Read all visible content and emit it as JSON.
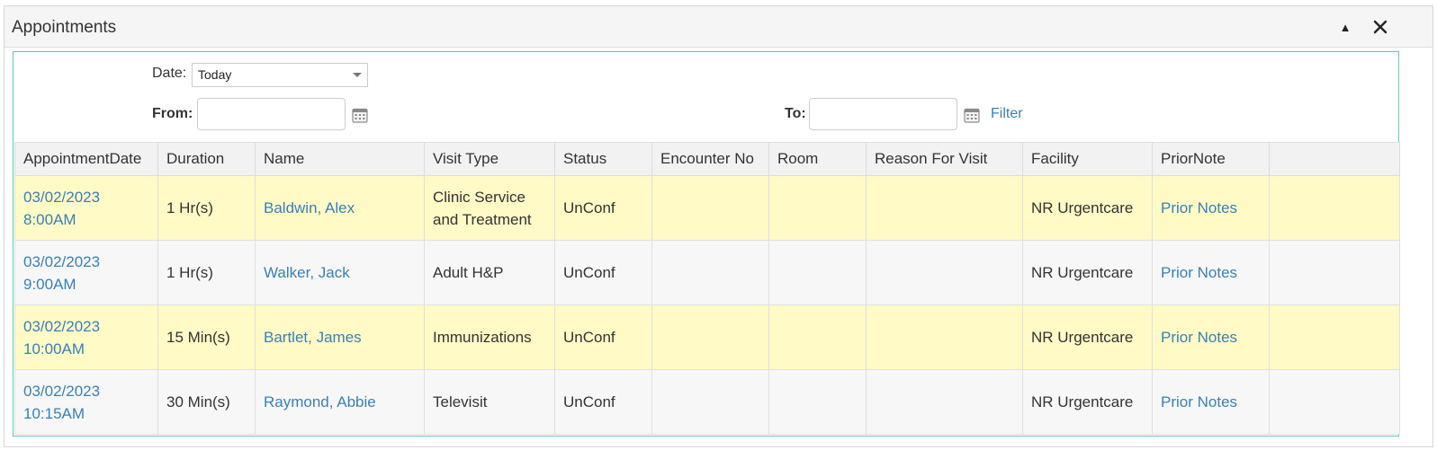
{
  "panel": {
    "title": "Appointments"
  },
  "filters": {
    "date_label": "Date:",
    "date_value": "Today",
    "from_label": "From:",
    "from_value": "",
    "to_label": "To:",
    "to_value": "",
    "filter_label": "Filter"
  },
  "table": {
    "columns": [
      "AppointmentDate",
      "Duration",
      "Name",
      "Visit Type",
      "Status",
      "Encounter No",
      "Room",
      "Reason For Visit",
      "Facility",
      "PriorNote",
      ""
    ],
    "rows": [
      {
        "date": "03/02/2023",
        "time": "8:00AM",
        "duration": "1 Hr(s)",
        "name": "Baldwin, Alex",
        "visit_type": "Clinic Service and Treatment",
        "status": "UnConf",
        "encounter_no": "",
        "room": "",
        "reason": "",
        "facility": "NR Urgentcare",
        "prior_note": "Prior Notes"
      },
      {
        "date": "03/02/2023",
        "time": "9:00AM",
        "duration": "1 Hr(s)",
        "name": "Walker, Jack",
        "visit_type": "Adult H&P",
        "status": "UnConf",
        "encounter_no": "",
        "room": "",
        "reason": "",
        "facility": "NR Urgentcare",
        "prior_note": "Prior Notes"
      },
      {
        "date": "03/02/2023",
        "time": "10:00AM",
        "duration": "15 Min(s)",
        "name": "Bartlet, James",
        "visit_type": "Immunizations",
        "status": "UnConf",
        "encounter_no": "",
        "room": "",
        "reason": "",
        "facility": "NR Urgentcare",
        "prior_note": "Prior Notes"
      },
      {
        "date": "03/02/2023",
        "time": "10:15AM",
        "duration": "30 Min(s)",
        "name": "Raymond, Abbie",
        "visit_type": "Televisit",
        "status": "UnConf",
        "encounter_no": "",
        "room": "",
        "reason": "",
        "facility": "NR Urgentcare",
        "prior_note": "Prior Notes"
      }
    ]
  },
  "icons": {
    "collapse": "triangle-up-icon",
    "close": "close-icon",
    "calendar": "calendar-icon"
  }
}
